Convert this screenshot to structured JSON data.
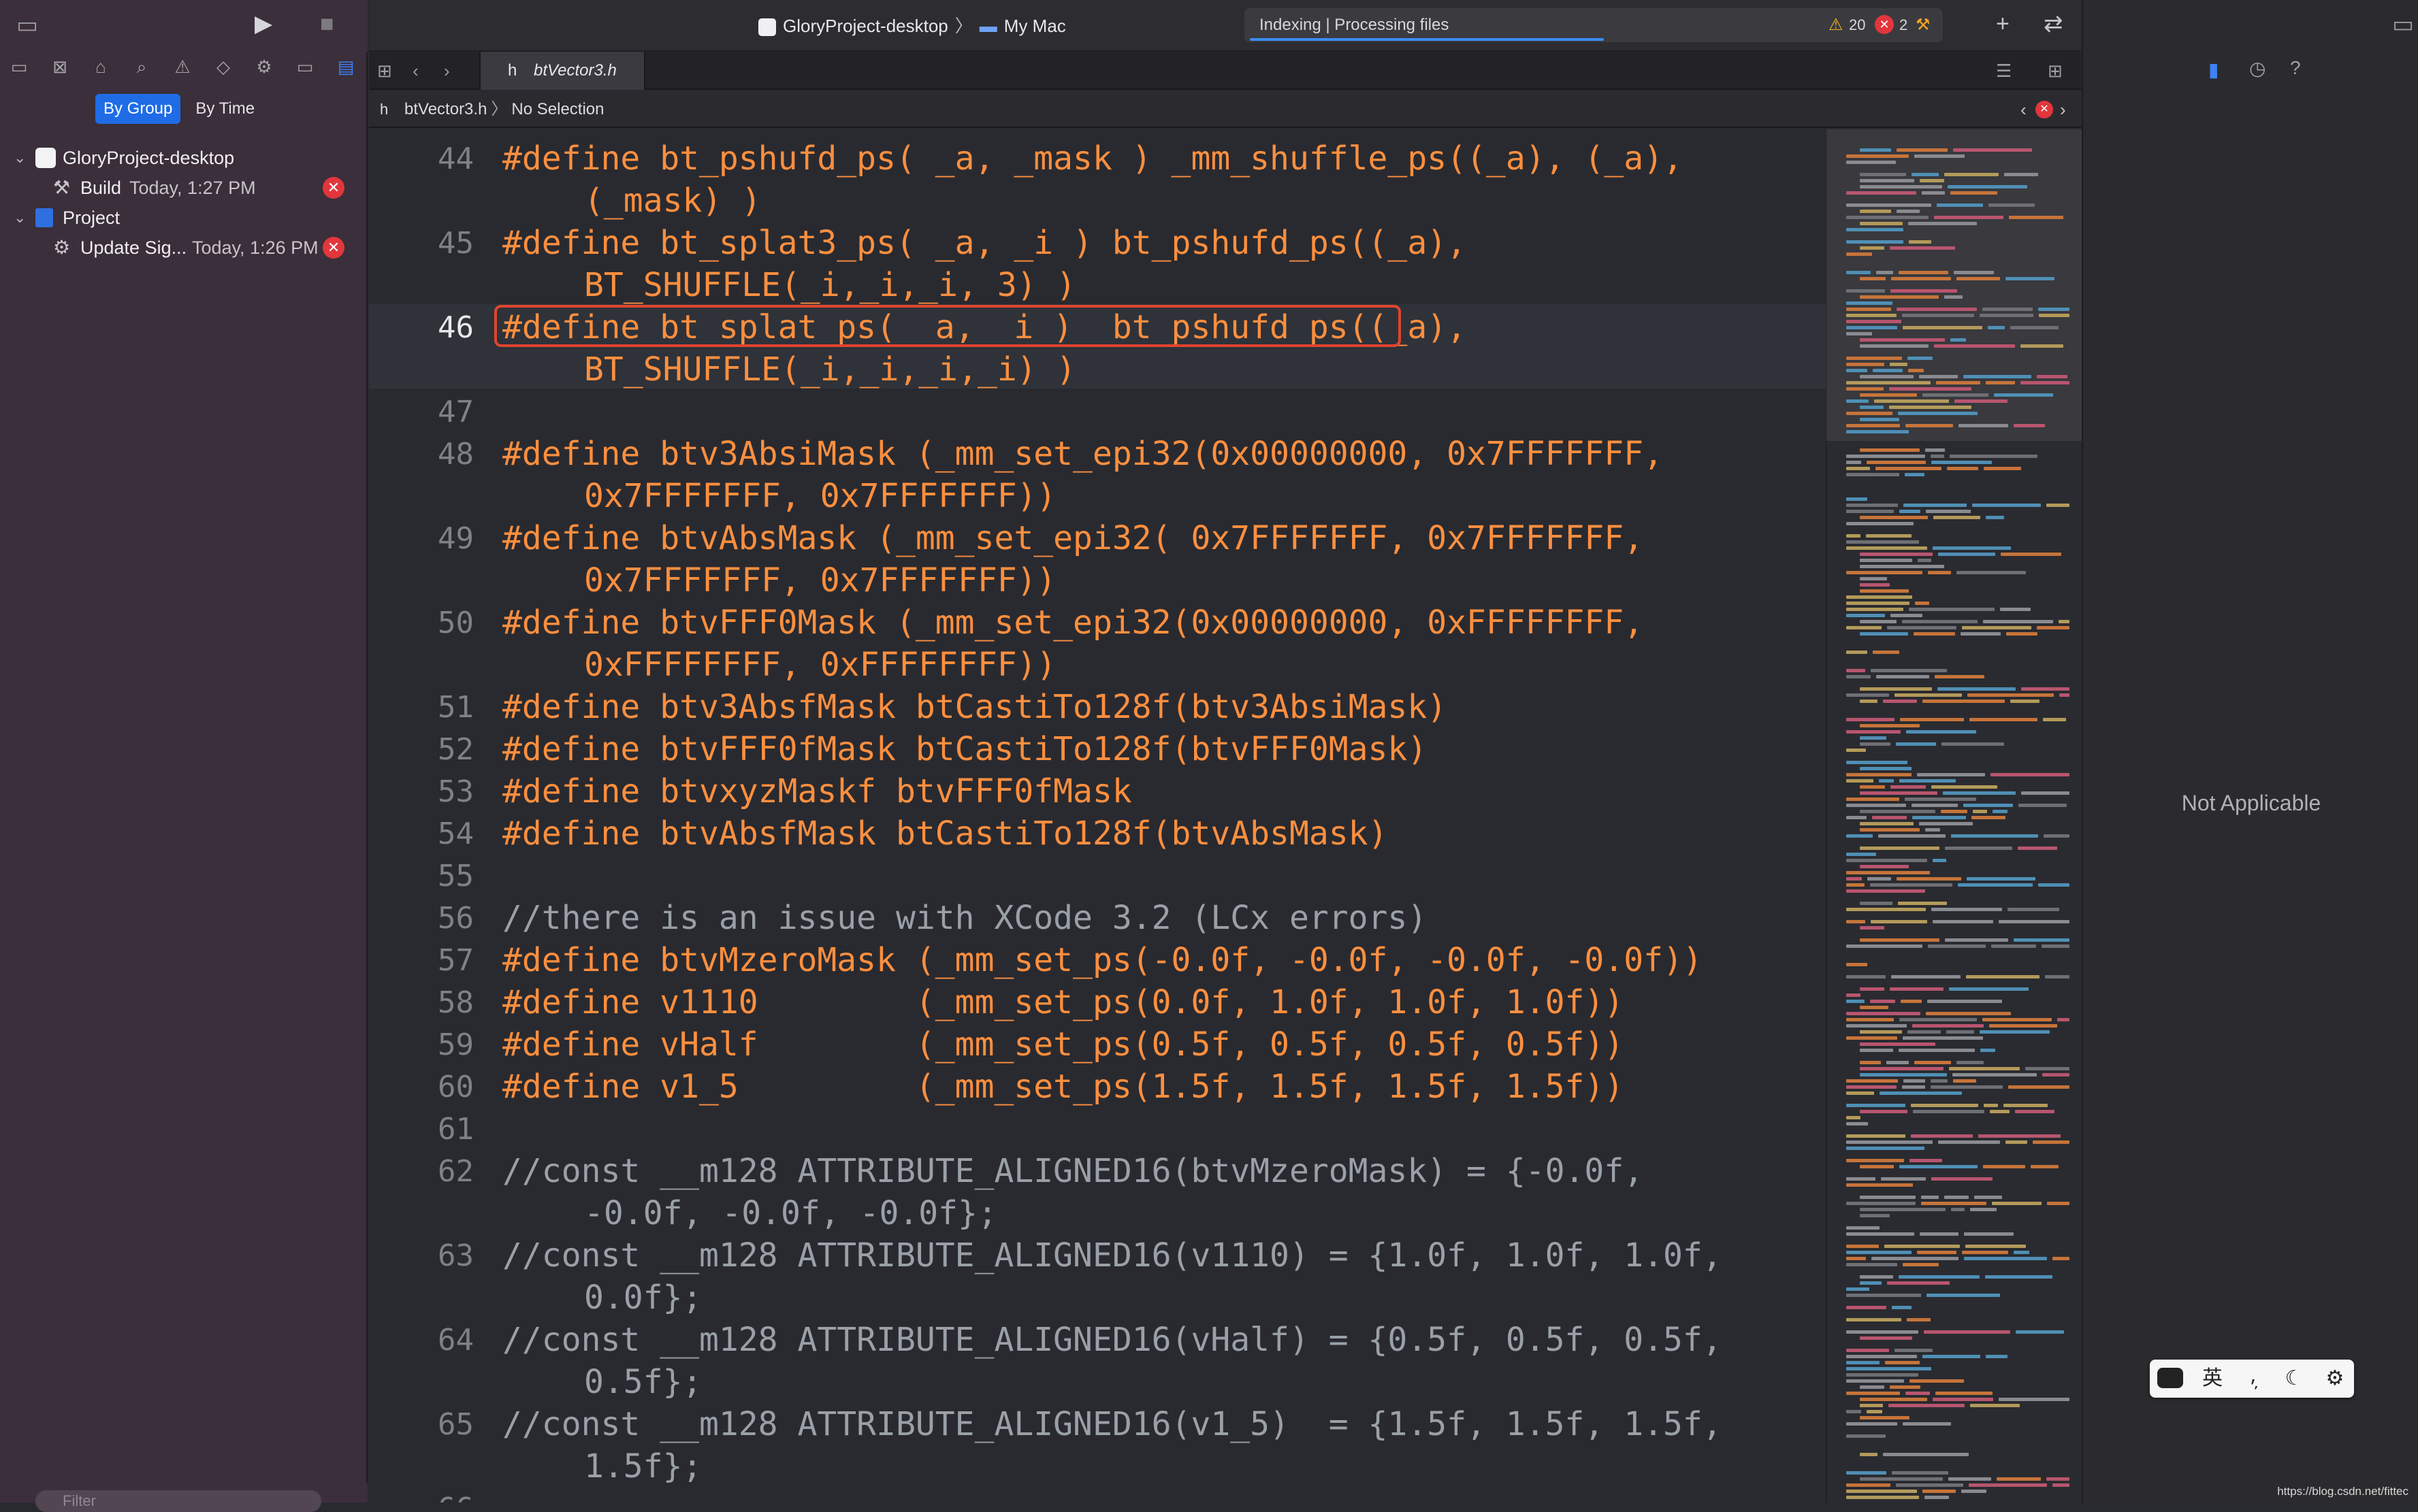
{
  "window": {
    "scheme": "GloryProject-desktop",
    "destination": "My Mac",
    "activity_text": "Indexing | Processing files",
    "warning_count": "20",
    "error_count": "2"
  },
  "navigator": {
    "scope_by_group": "By Group",
    "scope_by_time": "By Time",
    "project_name": "GloryProject-desktop",
    "build_label": "Build",
    "build_time": "Today, 1:27 PM",
    "project_label": "Project",
    "update_label": "Update Sig...",
    "update_time": "Today, 1:26 PM",
    "filter_placeholder": "Filter"
  },
  "tab": {
    "file_name": "btVector3.h"
  },
  "jumpbar": {
    "file": "btVector3.h",
    "selection": "No Selection"
  },
  "editor": {
    "lines": [
      {
        "n": "44",
        "t": "#define bt_pshufd_ps( _a, _mask ) _mm_shuffle_ps((_a), (_a),",
        "c": "(_mask) )"
      },
      {
        "n": "45",
        "t": "#define bt_splat3_ps( _a, _i ) bt_pshufd_ps((_a),",
        "c": "BT_SHUFFLE(_i,_i,_i, 3) )"
      },
      {
        "n": "46",
        "t": "#define bt_splat_ps( _a, _i )  bt_pshufd_ps((_a),",
        "c": "BT_SHUFFLE(_i,_i,_i,_i) )"
      },
      {
        "n": "47",
        "t": ""
      },
      {
        "n": "48",
        "t": "#define btv3AbsiMask (_mm_set_epi32(0x00000000, 0x7FFFFFFF,",
        "c": "0x7FFFFFFF, 0x7FFFFFFF))"
      },
      {
        "n": "49",
        "t": "#define btvAbsMask (_mm_set_epi32( 0x7FFFFFFF, 0x7FFFFFFF,",
        "c": "0x7FFFFFFF, 0x7FFFFFFF))"
      },
      {
        "n": "50",
        "t": "#define btvFFF0Mask (_mm_set_epi32(0x00000000, 0xFFFFFFFF,",
        "c": "0xFFFFFFFF, 0xFFFFFFFF))"
      },
      {
        "n": "51",
        "t": "#define btv3AbsfMask btCastiTo128f(btv3AbsiMask)"
      },
      {
        "n": "52",
        "t": "#define btvFFF0fMask btCastiTo128f(btvFFF0Mask)"
      },
      {
        "n": "53",
        "t": "#define btvxyzMaskf btvFFF0fMask"
      },
      {
        "n": "54",
        "t": "#define btvAbsfMask btCastiTo128f(btvAbsMask)"
      },
      {
        "n": "55",
        "t": ""
      },
      {
        "n": "56",
        "t": "//there is an issue with XCode 3.2 (LCx errors)"
      },
      {
        "n": "57",
        "t": "#define btvMzeroMask (_mm_set_ps(-0.0f, -0.0f, -0.0f, -0.0f))"
      },
      {
        "n": "58",
        "t": "#define v1110        (_mm_set_ps(0.0f, 1.0f, 1.0f, 1.0f))"
      },
      {
        "n": "59",
        "t": "#define vHalf        (_mm_set_ps(0.5f, 0.5f, 0.5f, 0.5f))"
      },
      {
        "n": "60",
        "t": "#define v1_5         (_mm_set_ps(1.5f, 1.5f, 1.5f, 1.5f))"
      },
      {
        "n": "61",
        "t": ""
      },
      {
        "n": "62",
        "t": "//const __m128 ATTRIBUTE_ALIGNED16(btvMzeroMask) = {-0.0f,",
        "c": "-0.0f, -0.0f, -0.0f};"
      },
      {
        "n": "63",
        "t": "//const __m128 ATTRIBUTE_ALIGNED16(v1110) = {1.0f, 1.0f, 1.0f,",
        "c": "0.0f};"
      },
      {
        "n": "64",
        "t": "//const __m128 ATTRIBUTE_ALIGNED16(vHalf) = {0.5f, 0.5f, 0.5f,",
        "c": "0.5f};"
      },
      {
        "n": "65",
        "t": "//const __m128 ATTRIBUTE_ALIGNED16(v1_5)  = {1.5f, 1.5f, 1.5f,",
        "c": "1.5f};"
      },
      {
        "n": "66",
        "t": ""
      }
    ]
  },
  "inspector": {
    "empty_text": "Not Applicable"
  },
  "ime": {
    "lang": "英",
    "punct": "⸴̦"
  },
  "watermark": "https://blog.csdn.net/fittec",
  "colors": {
    "keyword_orange": "#fd8f3f",
    "comment_gray": "#9aa0a8",
    "highlight_red": "#e0452e",
    "selection_blue": "#1f6ce6",
    "error_red": "#e2363c"
  }
}
